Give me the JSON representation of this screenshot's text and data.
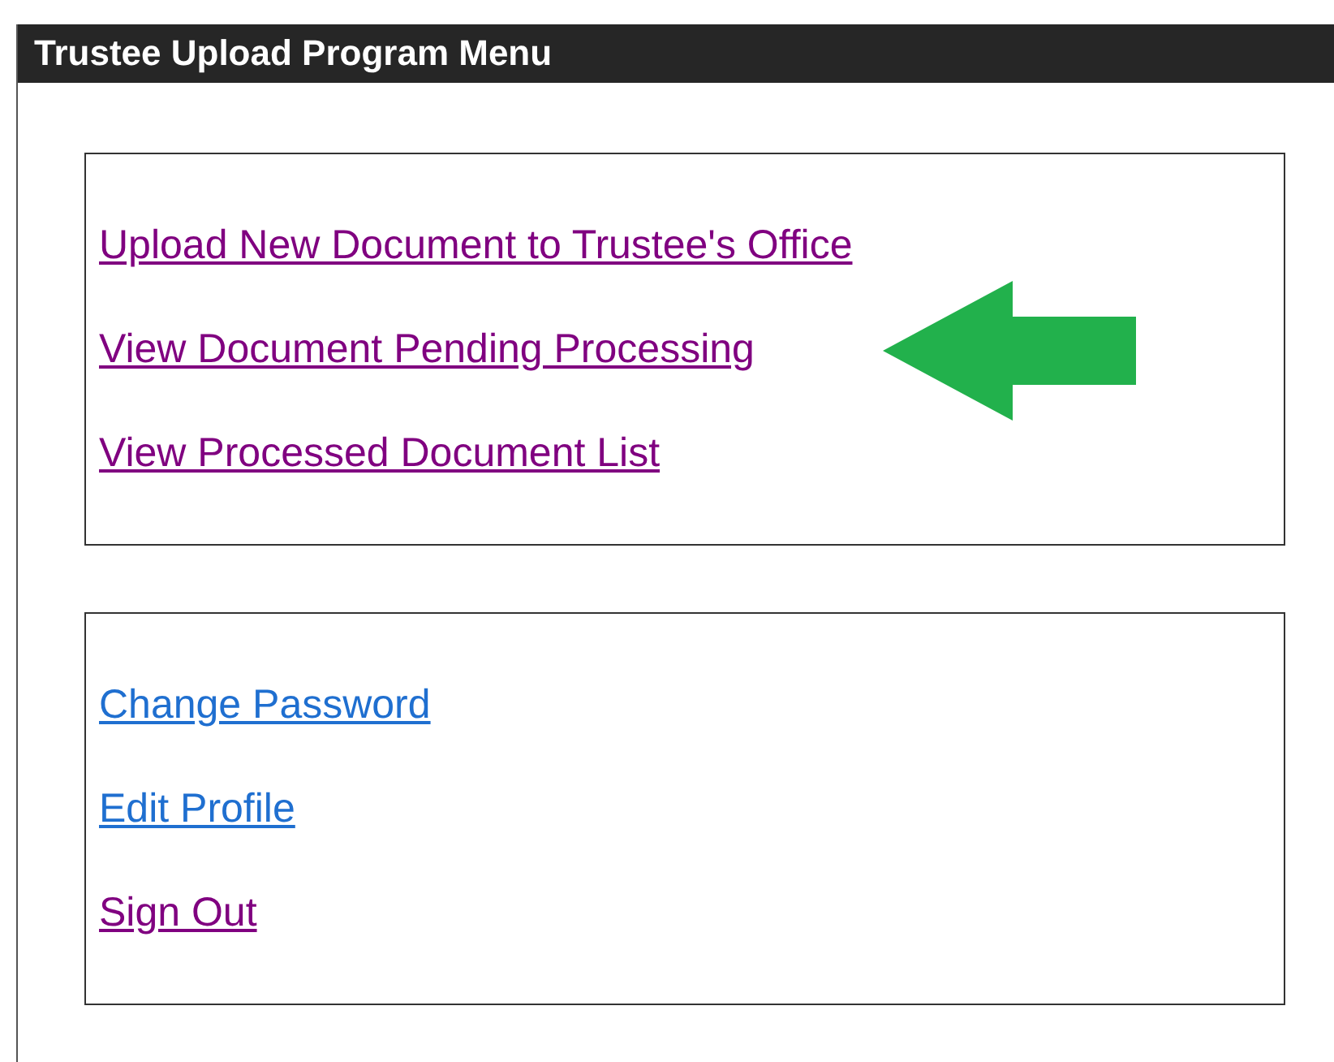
{
  "window": {
    "title": "Trustee Upload Program Menu"
  },
  "sections": [
    {
      "links": [
        {
          "label": "Upload New Document to Trustee's Office",
          "visited": true
        },
        {
          "label": "View Document Pending Processing",
          "visited": true
        },
        {
          "label": "View Processed Document List",
          "visited": true
        }
      ]
    },
    {
      "links": [
        {
          "label": "Change Password",
          "visited": false
        },
        {
          "label": "Edit Profile",
          "visited": false
        },
        {
          "label": "Sign Out",
          "visited": true
        }
      ]
    }
  ]
}
